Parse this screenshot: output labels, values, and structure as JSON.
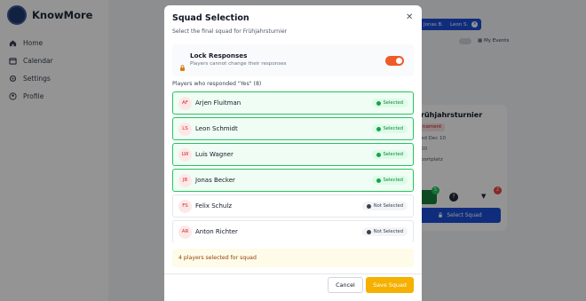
{
  "app": {
    "brand": "KnowMore"
  },
  "sidebar": {
    "items": [
      {
        "label": "Home",
        "icon": "home-icon"
      },
      {
        "label": "Calendar",
        "icon": "calendar-icon"
      },
      {
        "label": "Settings",
        "icon": "gear-icon"
      },
      {
        "label": "Profile",
        "icon": "user-icon"
      }
    ]
  },
  "background": {
    "chips": [
      {
        "label": "Jonas B."
      },
      {
        "label": "Leon S."
      }
    ],
    "my_events_label": "My Events",
    "card": {
      "title": "rühjahrsturnier",
      "tag": "nament",
      "date": "ed Dec 10",
      "time": "00",
      "location": "portplatz",
      "yes_count": "5",
      "no_count": "2",
      "select_squad_label": "Select Squad"
    }
  },
  "modal": {
    "title": "Squad Selection",
    "subtitle": "Select the final squad for Frühjahrsturnier",
    "lock": {
      "title": "Lock Responses",
      "description": "Players cannot change their responses",
      "enabled": true
    },
    "section_label": "Players who responded \"Yes\" (8)",
    "players": [
      {
        "initials": "AF",
        "name": "Arjen Fluitman",
        "status": "Selected",
        "selected": true
      },
      {
        "initials": "LS",
        "name": "Leon Schmidt",
        "status": "Selected",
        "selected": true
      },
      {
        "initials": "LW",
        "name": "Luis Wagner",
        "status": "Selected",
        "selected": true
      },
      {
        "initials": "JB",
        "name": "Jonas Becker",
        "status": "Selected",
        "selected": true
      },
      {
        "initials": "FS",
        "name": "Felix Schulz",
        "status": "Not Selected",
        "selected": false
      },
      {
        "initials": "AR",
        "name": "Anton Richter",
        "status": "Not Selected",
        "selected": false
      }
    ],
    "summary": "4 players selected for squad",
    "cancel_label": "Cancel",
    "save_label": "Save Squad",
    "colors": {
      "accent": "#f05a28",
      "save": "#f5b000",
      "selected_border": "#22c55e"
    }
  }
}
